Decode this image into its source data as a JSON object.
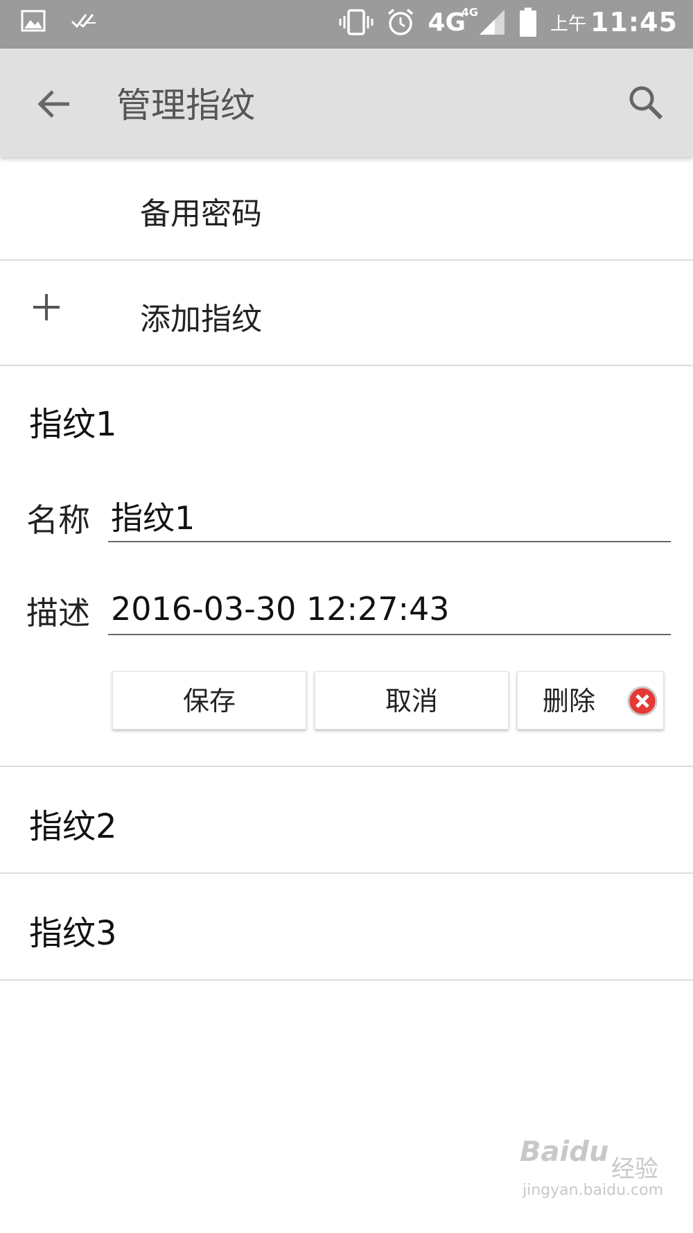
{
  "status_bar": {
    "ampm": "上午",
    "time": "11:45",
    "network": "4G",
    "network_small": "4G",
    "icons": [
      "gallery-icon",
      "checkmarks-icon",
      "vibrate-icon",
      "alarm-icon",
      "signal-icon",
      "battery-icon"
    ]
  },
  "app_bar": {
    "title": "管理指纹",
    "back_icon": "arrow-back-icon",
    "search_icon": "search-icon"
  },
  "list": {
    "backup_password": "备用密码",
    "add_fingerprint": "添加指纹"
  },
  "expanded": {
    "title": "指纹1",
    "name_label": "名称",
    "name_value": "指纹1",
    "desc_label": "描述",
    "desc_value": "2016-03-30 12:27:43",
    "save": "保存",
    "cancel": "取消",
    "delete": "删除"
  },
  "fingerprints": [
    {
      "label": "指纹2"
    },
    {
      "label": "指纹3"
    }
  ],
  "watermark": {
    "brand": "Baidu",
    "brand_cn": "经验",
    "url": "jingyan.baidu.com"
  },
  "colors": {
    "status_bar": "#9b9b9b",
    "app_bar": "#e0e0e0",
    "delete_icon": "#e53935"
  }
}
